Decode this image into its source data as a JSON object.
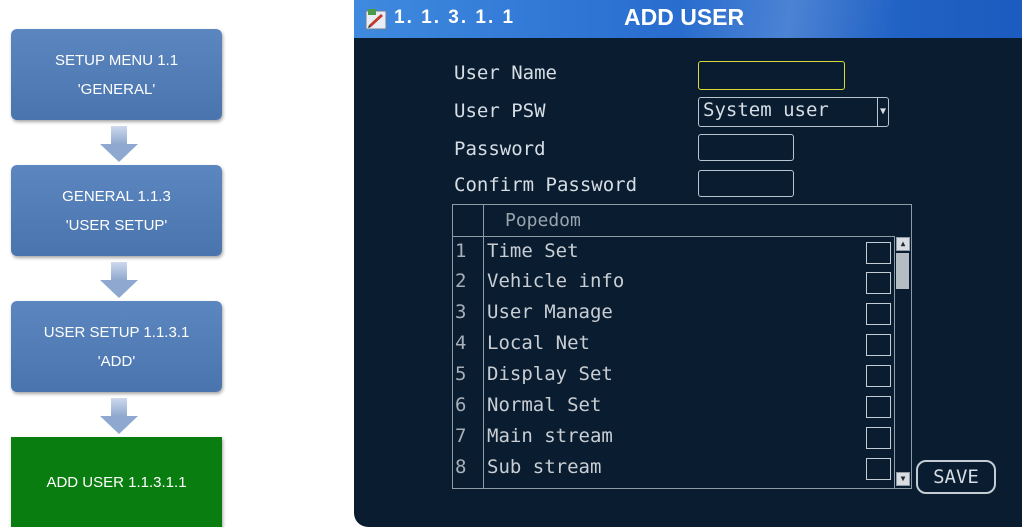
{
  "flow": {
    "steps": [
      {
        "line1": "SETUP MENU 1.1",
        "line2": "'GENERAL'"
      },
      {
        "line1": "GENERAL 1.1.3",
        "line2": "'USER SETUP'"
      },
      {
        "line1": "USER SETUP 1.1.3.1",
        "line2": "'ADD'"
      },
      {
        "line1": "ADD USER 1.1.3.1.1"
      }
    ],
    "colors": {
      "step": "#4f7bb8",
      "current": "#0a7d10",
      "arrow": "#8ea8cf"
    }
  },
  "screen": {
    "menu_number": "1. 1. 3. 1. 1",
    "title": "ADD USER",
    "form": {
      "user_name_label": "User Name",
      "user_name_value": "",
      "user_psw_label": "User PSW",
      "user_psw_value": "System user",
      "password_label": "Password",
      "password_value": "",
      "confirm_password_label": "Confirm Password",
      "confirm_password_value": ""
    },
    "popedom": {
      "header": "Popedom",
      "rows": [
        {
          "num": "1",
          "name": "Time Set",
          "checked": false
        },
        {
          "num": "2",
          "name": "Vehicle info",
          "checked": false
        },
        {
          "num": "3",
          "name": "User Manage",
          "checked": false
        },
        {
          "num": "4",
          "name": "Local Net",
          "checked": false
        },
        {
          "num": "5",
          "name": "Display Set",
          "checked": false
        },
        {
          "num": "6",
          "name": "Normal Set",
          "checked": false
        },
        {
          "num": "7",
          "name": "Main stream",
          "checked": false
        },
        {
          "num": "8",
          "name": "Sub stream",
          "checked": false
        }
      ]
    },
    "save_label": "SAVE",
    "colors": {
      "background": "#0a1c2f",
      "titlebar": "#2a6fd0",
      "focus": "#dada3a"
    }
  }
}
